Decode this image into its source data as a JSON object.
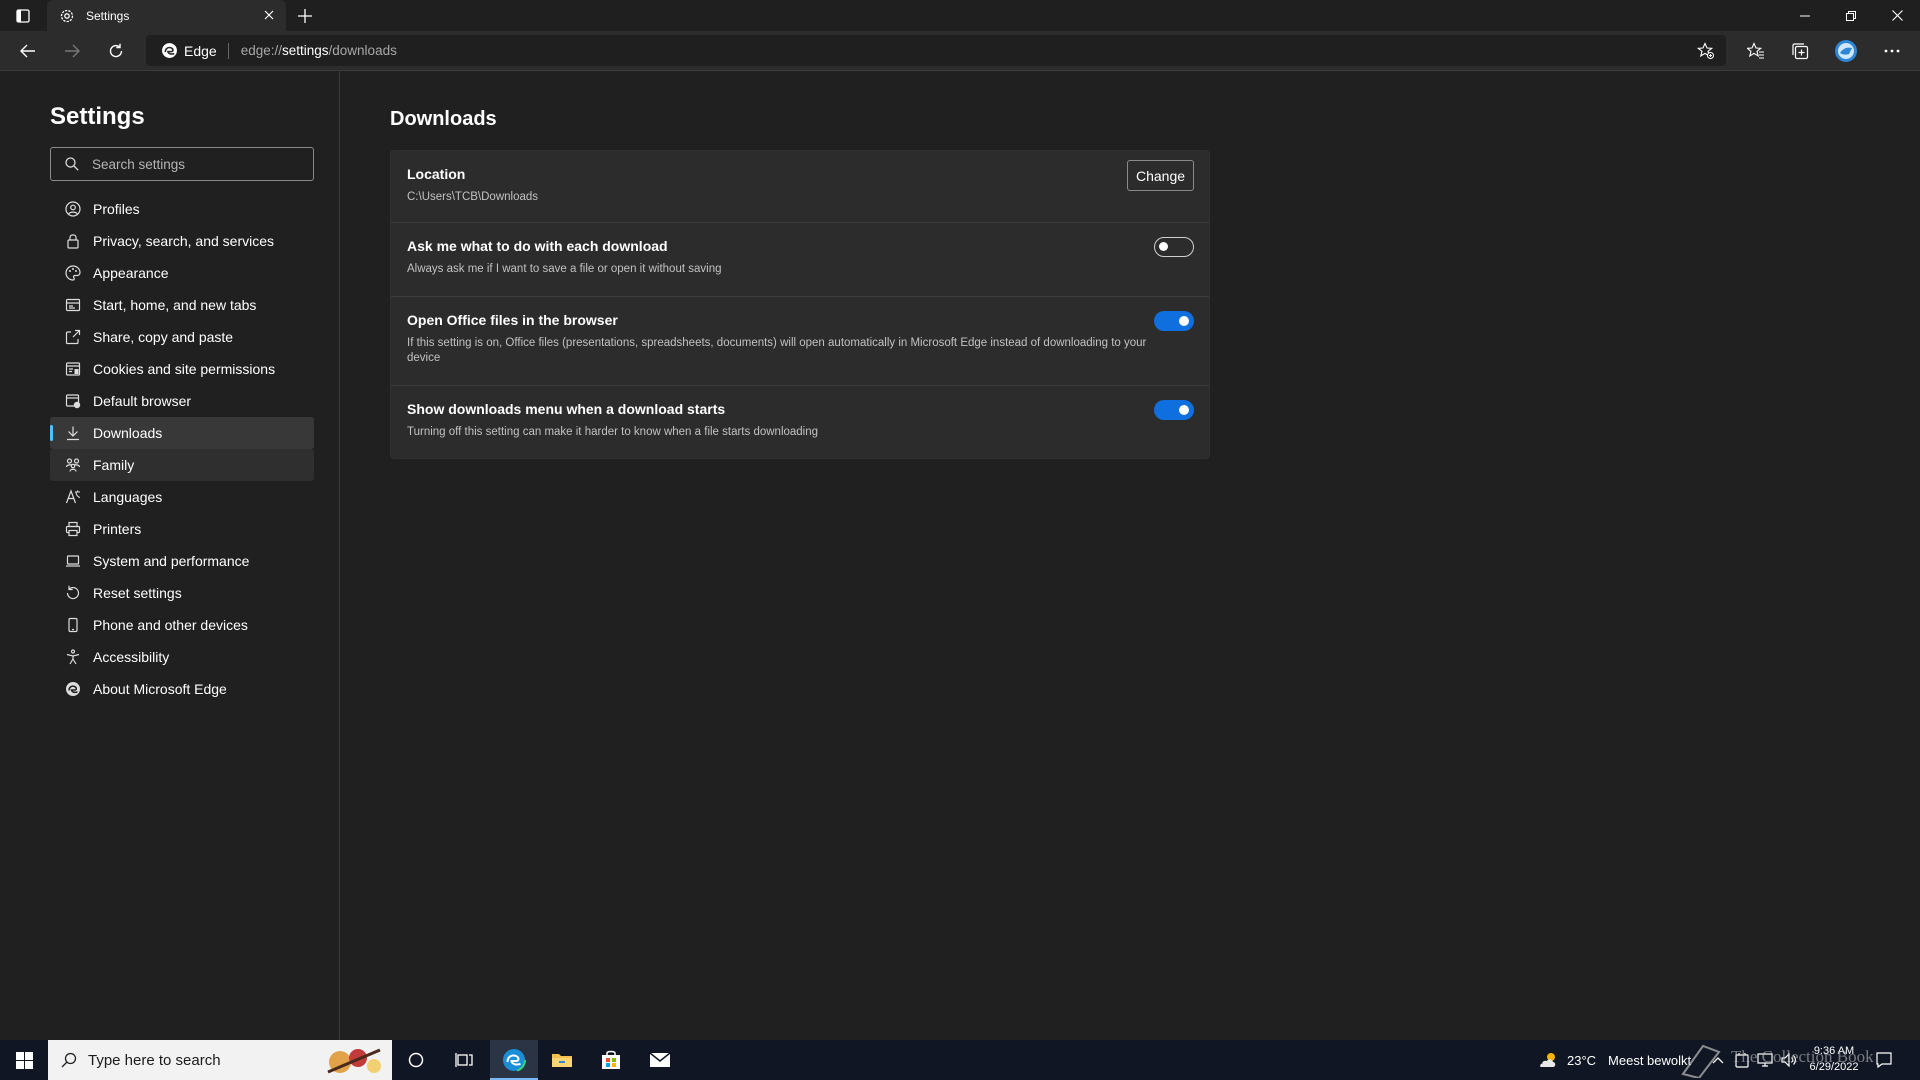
{
  "window": {
    "tab_title": "Settings"
  },
  "toolbar": {
    "site_label": "Edge",
    "url_scheme": "edge://",
    "url_host": "settings",
    "url_path": "/downloads"
  },
  "sidebar": {
    "title": "Settings",
    "search_placeholder": "Search settings",
    "items": [
      {
        "label": "Profiles",
        "icon": "profile-icon"
      },
      {
        "label": "Privacy, search, and services",
        "icon": "lock-icon"
      },
      {
        "label": "Appearance",
        "icon": "appearance-icon"
      },
      {
        "label": "Start, home, and new tabs",
        "icon": "start-icon"
      },
      {
        "label": "Share, copy and paste",
        "icon": "share-icon"
      },
      {
        "label": "Cookies and site permissions",
        "icon": "cookies-icon"
      },
      {
        "label": "Default browser",
        "icon": "default-browser-icon"
      },
      {
        "label": "Downloads",
        "icon": "download-icon",
        "active": true
      },
      {
        "label": "Family",
        "icon": "family-icon"
      },
      {
        "label": "Languages",
        "icon": "languages-icon"
      },
      {
        "label": "Printers",
        "icon": "printer-icon"
      },
      {
        "label": "System and performance",
        "icon": "laptop-icon"
      },
      {
        "label": "Reset settings",
        "icon": "reset-icon"
      },
      {
        "label": "Phone and other devices",
        "icon": "phone-icon"
      },
      {
        "label": "Accessibility",
        "icon": "accessibility-icon"
      },
      {
        "label": "About Microsoft Edge",
        "icon": "edge-icon"
      }
    ]
  },
  "main": {
    "title": "Downloads",
    "location": {
      "title": "Location",
      "path": "C:\\Users\\TCB\\Downloads",
      "button_label": "Change"
    },
    "settings": [
      {
        "title": "Ask me what to do with each download",
        "description": "Always ask me if I want to save a file or open it without saving",
        "enabled": false
      },
      {
        "title": "Open Office files in the browser",
        "description": "If this setting is on, Office files (presentations, spreadsheets, documents) will open automatically in Microsoft Edge instead of downloading to your device",
        "enabled": true
      },
      {
        "title": "Show downloads menu when a download starts",
        "description": "Turning off this setting can make it harder to know when a file starts downloading",
        "enabled": true
      }
    ]
  },
  "taskbar": {
    "search_placeholder": "Type here to search",
    "weather_temp": "23°C",
    "weather_text": "Meest bewolkt",
    "time": "9:36 AM",
    "date": "6/29/2022",
    "watermark": "The Collection Book"
  },
  "colors": {
    "accent": "#0f6fde",
    "active_indicator": "#4cc2ff",
    "background": "#202020",
    "card": "#2c2c2c"
  }
}
